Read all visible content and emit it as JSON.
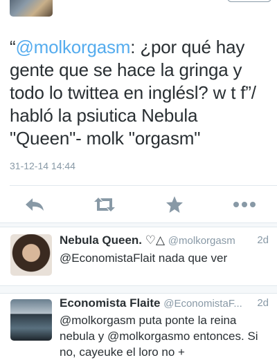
{
  "tweet": {
    "mention": "@molkorgasm",
    "open_quote": "“",
    "text": ": ¿por qué hay gente que se hace la gringa y todo lo twittea en inglésl? w t f”/ habló la psiutica Nebula \"Queen\"- molk \"orgasm\"",
    "timestamp": "31-12-14 14:44"
  },
  "actions": {
    "reply_icon": "reply-icon",
    "retweet_icon": "retweet-icon",
    "favorite_icon": "star-icon",
    "more_icon": "more-icon"
  },
  "replies": [
    {
      "name": "Nebula Queen. ♡△",
      "handle": "@molkorgasm",
      "time": "2d",
      "text": "@EconomistaFlait nada que ver"
    },
    {
      "name": "Economista Flaite",
      "handle": "@EconomistaF...",
      "time": "2d",
      "text": "@molkorgasm puta ponte la reina nebula y @molkorgasmo entonces. Si no, cayeuke el loro no +"
    }
  ],
  "colors": {
    "link": "#55acee",
    "icon": "#8899a6",
    "text": "#292f33"
  }
}
